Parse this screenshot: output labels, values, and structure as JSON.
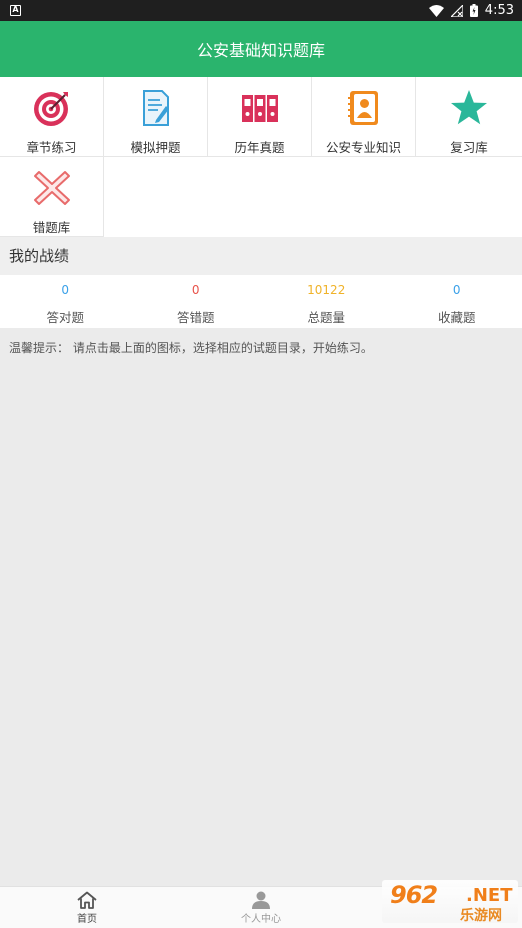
{
  "status_bar": {
    "time": "4:53",
    "notification_icon": "A"
  },
  "header": {
    "title": "公安基础知识题库"
  },
  "menu": {
    "items": [
      {
        "label": "章节练习",
        "icon": "target-icon"
      },
      {
        "label": "模拟押题",
        "icon": "document-edit-icon"
      },
      {
        "label": "历年真题",
        "icon": "binders-icon"
      },
      {
        "label": "公安专业知识",
        "icon": "contact-book-icon"
      },
      {
        "label": "复习库",
        "icon": "star-icon"
      },
      {
        "label": "错题库",
        "icon": "cross-icon"
      }
    ]
  },
  "stats_section": {
    "title": "我的战绩",
    "items": [
      {
        "value": "0",
        "label": "答对题",
        "color": "#3aa0e8"
      },
      {
        "value": "0",
        "label": "答错题",
        "color": "#e8524a"
      },
      {
        "value": "10122",
        "label": "总题量",
        "color": "#f0b32a"
      },
      {
        "value": "0",
        "label": "收藏题",
        "color": "#3aa0e8"
      }
    ]
  },
  "tip": "温馨提示： 请点击最上面的图标，选择相应的试题目录，开始练习。",
  "bottom_nav": {
    "items": [
      {
        "label": "首页",
        "icon": "home-icon"
      },
      {
        "label": "个人中心",
        "icon": "person-icon"
      },
      {
        "label": "",
        "icon": ""
      }
    ]
  },
  "watermark": {
    "num": "962",
    "net": ".NET",
    "cn": "乐游网"
  }
}
